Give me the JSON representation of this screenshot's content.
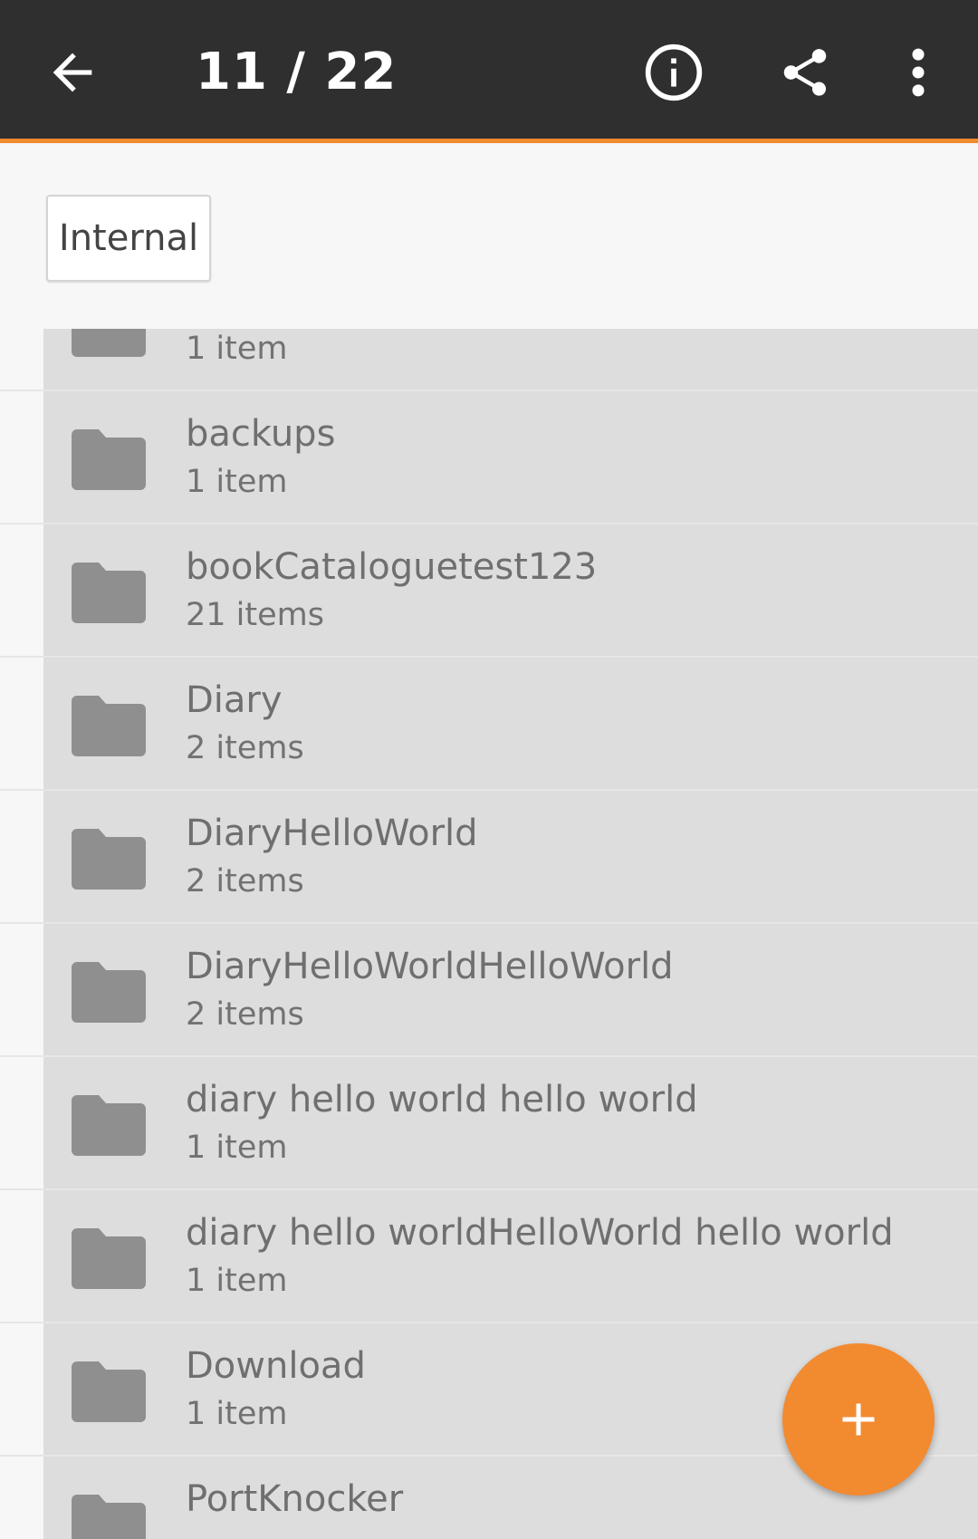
{
  "toolbar": {
    "title": "11 / 22",
    "icons": [
      "back-arrow-icon",
      "info-icon",
      "share-icon",
      "more-vert-icon"
    ]
  },
  "breadcrumb": {
    "storage_label": "Internal"
  },
  "folders": [
    {
      "name": "",
      "count": "1 item"
    },
    {
      "name": "backups",
      "count": "1 item"
    },
    {
      "name": "bookCataloguetest123",
      "count": "21 items"
    },
    {
      "name": "Diary",
      "count": "2 items"
    },
    {
      "name": "DiaryHelloWorld",
      "count": "2 items"
    },
    {
      "name": "DiaryHelloWorldHelloWorld",
      "count": "2 items"
    },
    {
      "name": "diary hello world hello world",
      "count": "1 item"
    },
    {
      "name": "diary hello worldHelloWorld hello world",
      "count": "1 item"
    },
    {
      "name": "Download",
      "count": "1 item"
    },
    {
      "name": "PortKnocker",
      "count": ""
    }
  ],
  "fab": {
    "icon": "plus-icon"
  },
  "colors": {
    "toolbar_bg": "#2f2f2f",
    "accent": "#f28a30",
    "list_item_bg": "#dddddd",
    "folder_icon": "#8f8f8f"
  }
}
